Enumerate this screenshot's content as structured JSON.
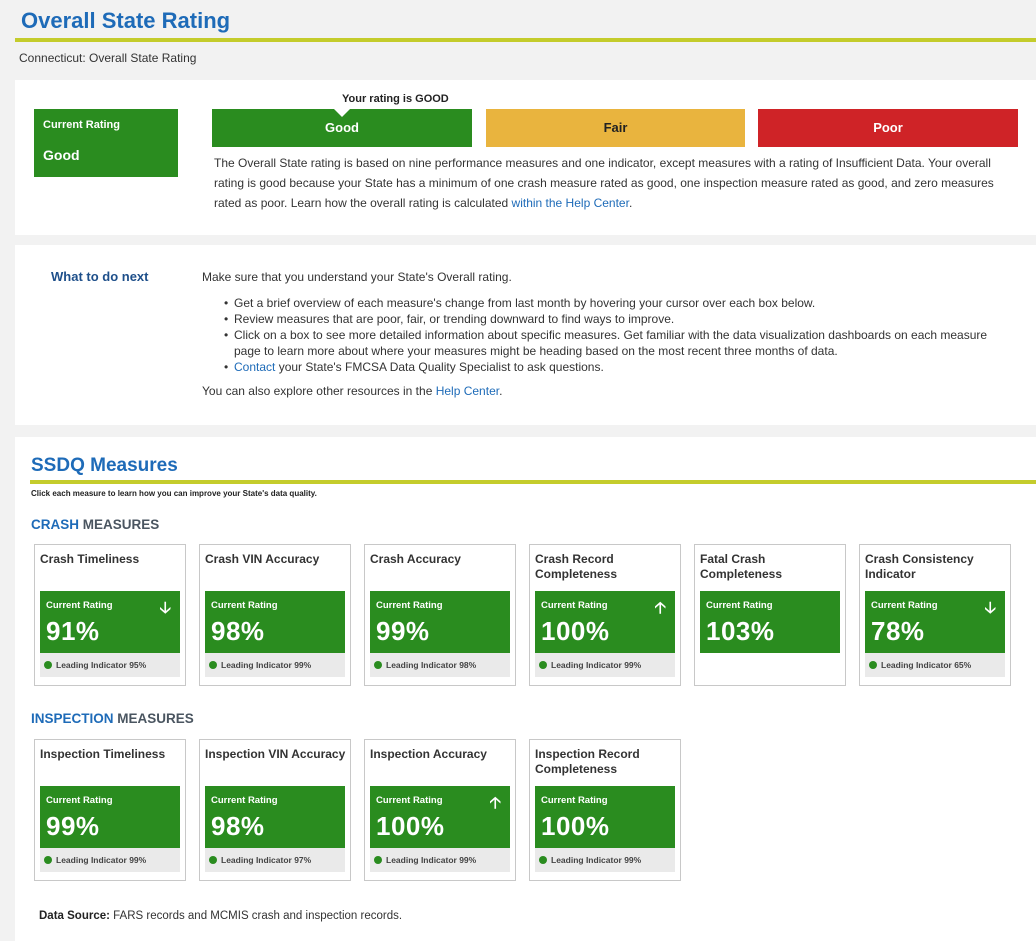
{
  "page": {
    "title": "Overall State Rating",
    "breadcrumb": "Connecticut: Overall State Rating"
  },
  "rating": {
    "current_label": "Current Rating",
    "current_value": "Good",
    "your_rating_text": "Your rating is GOOD",
    "scale": [
      "Good",
      "Fair",
      "Poor"
    ],
    "description": "The Overall State rating is based on nine performance measures and one indicator, except measures with a rating of Insufficient Data. Your overall rating is good because your State has a minimum of one crash measure rated as good, one inspection measure rated as good, and zero measures rated as poor. Learn how the overall rating is calculated",
    "help_link": "within the Help Center",
    "description_end": "."
  },
  "next": {
    "title": "What to do next",
    "intro": "Make sure that you understand your State's Overall rating.",
    "bullets": [
      "Get a brief overview of each measure's change from last month by hovering your cursor over each box below.",
      "Review measures that are poor, fair, or trending downward to find ways to improve.",
      "Click on a box to see more detailed information about specific measures. Get familiar with the data visualization dashboards on each measure page to learn more about where your measures might be heading based on the most recent three months of data."
    ],
    "contact_link": "Contact",
    "contact_text": " your State's FMCSA Data Quality Specialist to ask questions.",
    "explore_text": "You can also explore other resources in the ",
    "help_center_link": "Help Center",
    "explore_end": "."
  },
  "ssdq": {
    "title": "SSDQ Measures",
    "subtitle": "Click each measure to learn how you can improve your State's data quality.",
    "crash_accent": "CRASH",
    "inspection_accent": "INSPECTION",
    "measures_word": " MEASURES",
    "rating_label": "Current Rating",
    "crash": [
      {
        "name": "Crash Timeliness",
        "value": "91%",
        "arrow": "🡣",
        "leading": "Leading Indicator 95%"
      },
      {
        "name": "Crash VIN Accuracy",
        "value": "98%",
        "arrow": "",
        "leading": "Leading Indicator 99%"
      },
      {
        "name": "Crash Accuracy",
        "value": "99%",
        "arrow": "",
        "leading": "Leading Indicator 98%"
      },
      {
        "name": "Crash Record Completeness",
        "value": "100%",
        "arrow": "🡡",
        "leading": "Leading Indicator 99%"
      },
      {
        "name": "Fatal Crash Completeness",
        "value": "103%",
        "arrow": "",
        "leading": ""
      },
      {
        "name": "Crash Consistency Indicator",
        "value": "78%",
        "arrow": "🡣",
        "leading": "Leading Indicator 65%"
      }
    ],
    "inspection": [
      {
        "name": "Inspection Timeliness",
        "value": "99%",
        "arrow": "",
        "leading": "Leading Indicator 99%"
      },
      {
        "name": "Inspection VIN Accuracy",
        "value": "98%",
        "arrow": "",
        "leading": "Leading Indicator 97%"
      },
      {
        "name": "Inspection Accuracy",
        "value": "100%",
        "arrow": "🡡",
        "leading": "Leading Indicator 99%"
      },
      {
        "name": "Inspection Record Completeness",
        "value": "100%",
        "arrow": "",
        "leading": "Leading Indicator 99%"
      }
    ],
    "data_source_label": "Data Source:",
    "data_source_text": " FARS records and MCMIS crash and inspection records."
  },
  "colors": {
    "good": "#2a8c1f",
    "fair": "#e9b43e",
    "poor": "#cf2327",
    "accent_blue": "#1e6bb8",
    "rule": "#c4cc2c"
  },
  "icons": {
    "down": "arrow-down-icon",
    "up": "arrow-up-icon",
    "leading": "status-dot-icon"
  }
}
